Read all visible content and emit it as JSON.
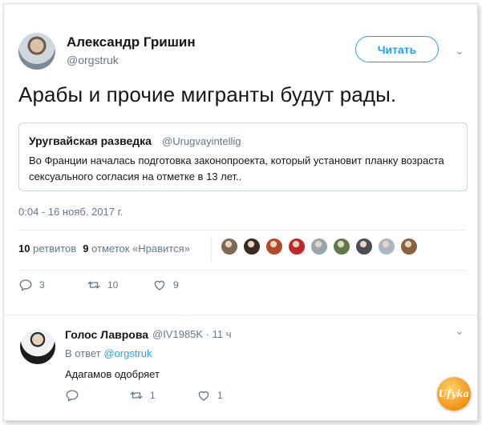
{
  "tweet": {
    "author_name": "Александр Гришин",
    "author_handle": "@orgstruk",
    "follow_label": "Читать",
    "text": "Арабы и прочие мигранты будут рады.",
    "timestamp": "0:04 - 16 нояб. 2017 г."
  },
  "quote": {
    "name": "Уругвайская разведка",
    "handle": "@Urugvayintellig",
    "text": "Во Франции началась подготовка законопроекта, который установит планку возраста сексуального согласия на отметке в 13 лет.."
  },
  "stats": {
    "retweets_count": "10",
    "retweets_label": "ретвитов",
    "likes_count": "9",
    "likes_label": "отметок «Нравится»"
  },
  "likers": [
    {
      "icon": "avatar-icon",
      "color": "#7d6a55"
    },
    {
      "icon": "avatar-icon",
      "color": "#3a2c22"
    },
    {
      "icon": "avatar-icon",
      "color": "#b24a28"
    },
    {
      "icon": "avatar-icon",
      "color": "#c0262a"
    },
    {
      "icon": "avatar-icon",
      "color": "#9aa6ae"
    },
    {
      "icon": "avatar-icon",
      "color": "#5d7a4a"
    },
    {
      "icon": "avatar-icon",
      "color": "#4a4f55"
    },
    {
      "icon": "avatar-icon",
      "color": "#a9b6c4"
    },
    {
      "icon": "avatar-icon",
      "color": "#8a6240"
    }
  ],
  "actions": {
    "replies": "3",
    "retweets": "10",
    "likes": "9"
  },
  "reply": {
    "name": "Голос Лаврова",
    "handle": "@IV1985K · 11 ч",
    "reply_to_prefix": "В ответ",
    "reply_to_handle": "@orgstruk",
    "text": "Адагамов одобряет",
    "actions": {
      "replies": "",
      "retweets": "1",
      "likes": "1"
    }
  },
  "watermark": {
    "text": "Ufyka"
  },
  "colors": {
    "accent": "#1da1f2",
    "secondary_text": "#657786",
    "divider": "#e6ecf0"
  }
}
